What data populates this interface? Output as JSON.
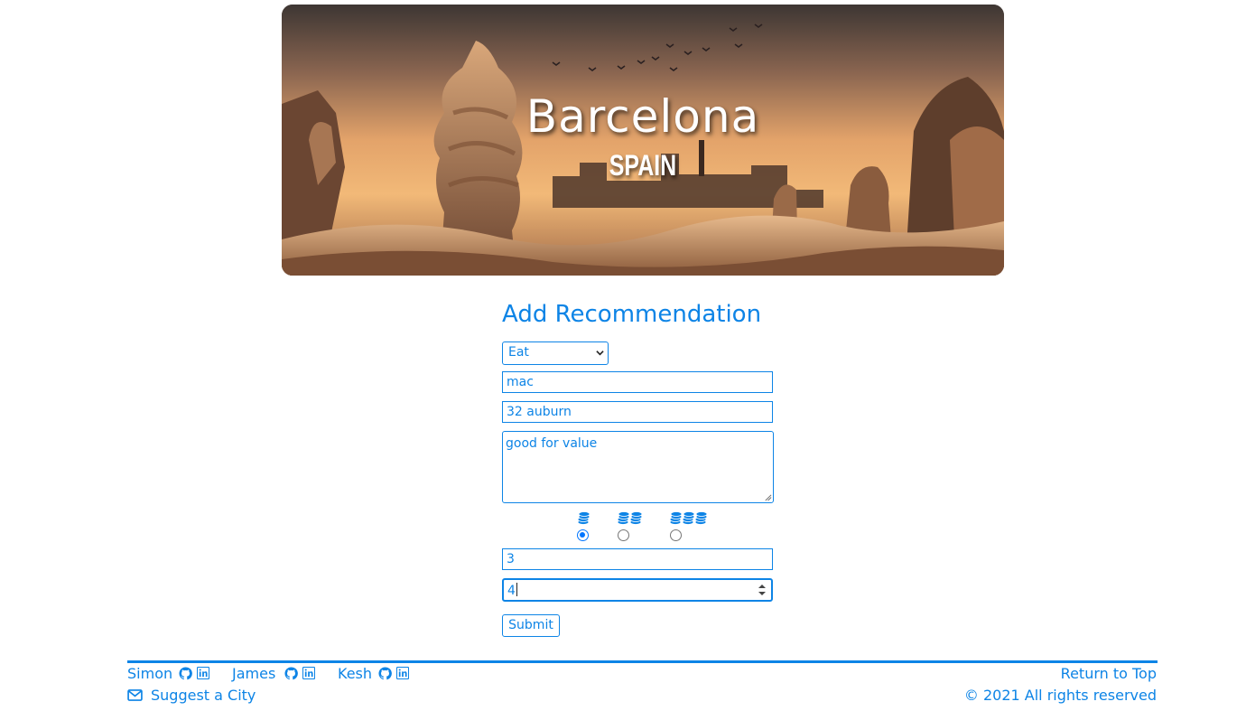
{
  "hero": {
    "city": "Barcelona",
    "country": "SPAIN"
  },
  "form": {
    "title": "Add Recommendation",
    "category": {
      "selected": "Eat"
    },
    "name": {
      "value": "mac"
    },
    "address": {
      "value": "32 auburn"
    },
    "description": {
      "value": "good for value"
    },
    "price": {
      "options": [
        {
          "icon": "coins-1-icon",
          "checked": true
        },
        {
          "icon": "coins-2-icon",
          "checked": false
        },
        {
          "icon": "coins-3-icon",
          "checked": false
        }
      ]
    },
    "rating": {
      "value": "3"
    },
    "number": {
      "value": "4"
    },
    "submit_label": "Submit"
  },
  "footer": {
    "authors": [
      {
        "name": "Simon",
        "icons": [
          "github-icon",
          "linkedin-icon"
        ]
      },
      {
        "name": "James",
        "icons": [
          "github-icon",
          "linkedin-icon"
        ]
      },
      {
        "name": "Kesh",
        "icons": [
          "github-icon",
          "linkedin-icon"
        ]
      }
    ],
    "suggest_label": "Suggest a City",
    "return_label": "Return to Top",
    "copyright": "© 2021 All rights reserved"
  },
  "colors": {
    "accent": "#0d84e6",
    "radio_checked": "#0075ff"
  }
}
